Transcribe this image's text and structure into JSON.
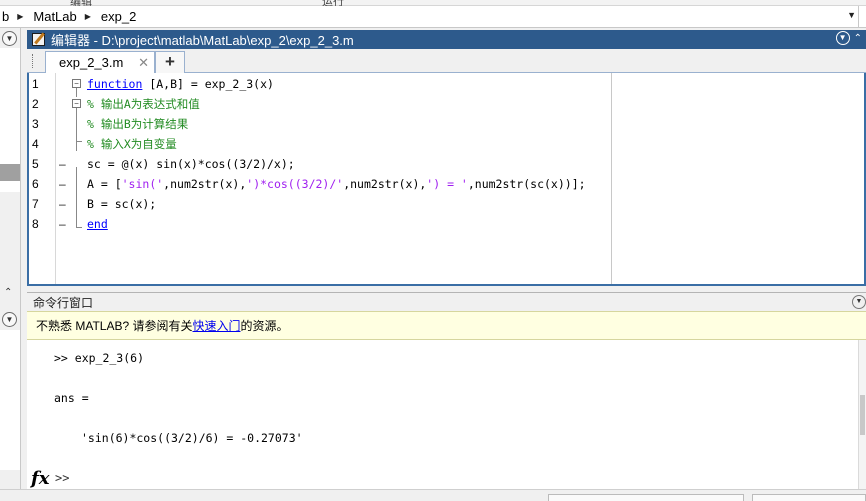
{
  "top_strip": {
    "left_text": "编辑",
    "mid_text": "运行"
  },
  "address_bar": {
    "segments": [
      "b",
      "MatLab",
      "exp_2"
    ]
  },
  "editor": {
    "title": "编辑器 - D:\\project\\matlab\\MatLab\\exp_2\\exp_2_3.m",
    "tab_label": "exp_2_3.m",
    "tab_close": "✕",
    "tab_add": "+",
    "lines": [
      {
        "num": "1",
        "dash": "",
        "parts": [
          {
            "t": "kw",
            "v": "function"
          },
          {
            "t": "n",
            "v": " [A,B] = exp_2_3(x)"
          }
        ]
      },
      {
        "num": "2",
        "dash": "",
        "parts": [
          {
            "t": "cm",
            "v": "% 输出A为表达式和值"
          }
        ]
      },
      {
        "num": "3",
        "dash": "",
        "parts": [
          {
            "t": "cm",
            "v": "% 输出B为计算结果"
          }
        ]
      },
      {
        "num": "4",
        "dash": "",
        "parts": [
          {
            "t": "cm",
            "v": "% 输入X为自变量"
          }
        ]
      },
      {
        "num": "5",
        "dash": "–",
        "parts": [
          {
            "t": "n",
            "v": "sc = @(x) sin(x)*cos((3/2)/x);"
          }
        ]
      },
      {
        "num": "6",
        "dash": "–",
        "parts": [
          {
            "t": "n",
            "v": "A = ["
          },
          {
            "t": "str",
            "v": "'sin('"
          },
          {
            "t": "n",
            "v": ",num2str(x),"
          },
          {
            "t": "str",
            "v": "')*cos((3/2)/'"
          },
          {
            "t": "n",
            "v": ",num2str(x),"
          },
          {
            "t": "str",
            "v": "') = '"
          },
          {
            "t": "n",
            "v": ",num2str(sc(x))];"
          }
        ]
      },
      {
        "num": "7",
        "dash": "–",
        "parts": [
          {
            "t": "n",
            "v": "B = sc(x);"
          }
        ]
      },
      {
        "num": "8",
        "dash": "–",
        "parts": [
          {
            "t": "kw",
            "v": "end"
          }
        ]
      }
    ]
  },
  "command_window": {
    "title": "命令行窗口",
    "notice_prefix": "不熟悉 MATLAB? 请参阅有关",
    "notice_link": "快速入门",
    "notice_suffix": "的资源。",
    "lines": [
      ">> exp_2_3(6)",
      "ans =",
      "'sin(6)*cos((3/2)/6) = -0.27073'"
    ],
    "fx_label": "fx",
    "prompt": ">>"
  }
}
